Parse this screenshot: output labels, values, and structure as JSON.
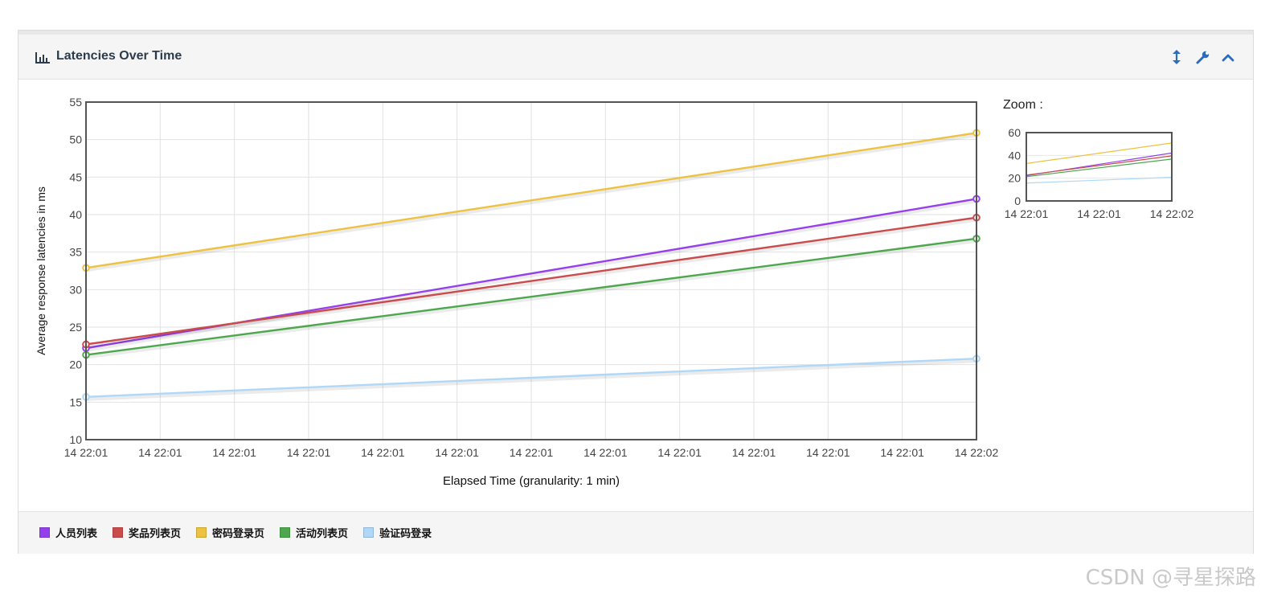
{
  "panel": {
    "title": "Latencies Over Time",
    "icons": [
      "bar-chart-icon",
      "resize-vertical-icon",
      "wrench-icon",
      "chevron-up-icon"
    ]
  },
  "chart_data": {
    "type": "line",
    "xlabel": "Elapsed Time (granularity: 1 min)",
    "ylabel": "Average response latencies in ms",
    "ylim": [
      10,
      55
    ],
    "yticks": [
      10,
      15,
      20,
      25,
      30,
      35,
      40,
      45,
      50,
      55
    ],
    "xticks": [
      "14 22:01",
      "14 22:01",
      "14 22:01",
      "14 22:01",
      "14 22:01",
      "14 22:01",
      "14 22:01",
      "14 22:01",
      "14 22:01",
      "14 22:01",
      "14 22:01",
      "14 22:01",
      "14 22:02"
    ],
    "x": [
      "14 22:01",
      "14 22:02"
    ],
    "grid": true,
    "series": [
      {
        "name": "人员列表",
        "color": "#9440ed",
        "values": [
          22.2,
          42.1
        ]
      },
      {
        "name": "奖品列表页",
        "color": "#cb4b4b",
        "values": [
          22.7,
          39.6
        ]
      },
      {
        "name": "密码登录页",
        "color": "#edc240",
        "values": [
          32.9,
          50.9
        ]
      },
      {
        "name": "活动列表页",
        "color": "#4da74d",
        "values": [
          21.3,
          36.8
        ]
      },
      {
        "name": "验证码登录",
        "color": "#afd8f8",
        "values": [
          15.7,
          20.8
        ]
      }
    ]
  },
  "zoom": {
    "label": "Zoom :",
    "ylim": [
      0,
      60
    ],
    "yticks": [
      0,
      20,
      40,
      60
    ],
    "xticks": [
      "14 22:01",
      "14 22:01",
      "14 22:02"
    ]
  },
  "watermark": "CSDN @寻星探路"
}
